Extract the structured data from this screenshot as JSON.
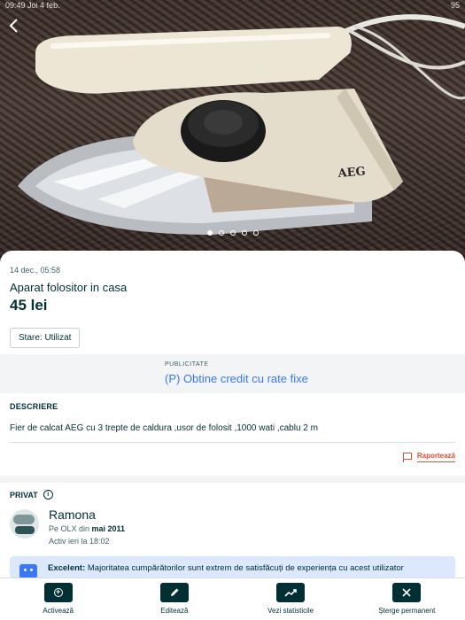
{
  "status_bar": {
    "time": "09:49",
    "carrier": "Joi 4 feb.",
    "battery": "95"
  },
  "listing": {
    "date": "14 dec., 05:58",
    "title": "Aparat folositor in casa",
    "price": "45 lei",
    "condition_chip": "Stare: Utilizat",
    "image_count": 5,
    "active_image_index": 0
  },
  "advertisement": {
    "label": "PUBLICITATE",
    "link_text": "(P) Obtine credit cu rate fixe"
  },
  "description": {
    "heading": "DESCRIERE",
    "text": "Fier de calcat AEG  cu 3 trepte de caldura ,usor de folosit ,1000 wati ,cablu 2 m",
    "report_label": "Raportează"
  },
  "seller": {
    "type_heading": "PRIVAT",
    "name": "Ramona",
    "member_prefix": "Pe OLX din ",
    "member_since": "mai 2011",
    "last_active": "Activ ieri la 18:02",
    "rating_bold": "Excelent:",
    "rating_text": " Majoritatea cumpărătorilor sunt extrem de satisfăcuți de experiența cu acest utilizator"
  },
  "actions": [
    {
      "label": "Activează",
      "icon": "plus-circle-icon"
    },
    {
      "label": "Editează",
      "icon": "pencil-icon"
    },
    {
      "label": "Vezi statisticile",
      "icon": "trend-icon"
    },
    {
      "label": "Șterge permanent",
      "icon": "close-icon"
    }
  ],
  "colors": {
    "primary": "#002f34",
    "link": "#3a77ff",
    "report": "#e04e31",
    "rating_bg": "#dbe8fe"
  }
}
